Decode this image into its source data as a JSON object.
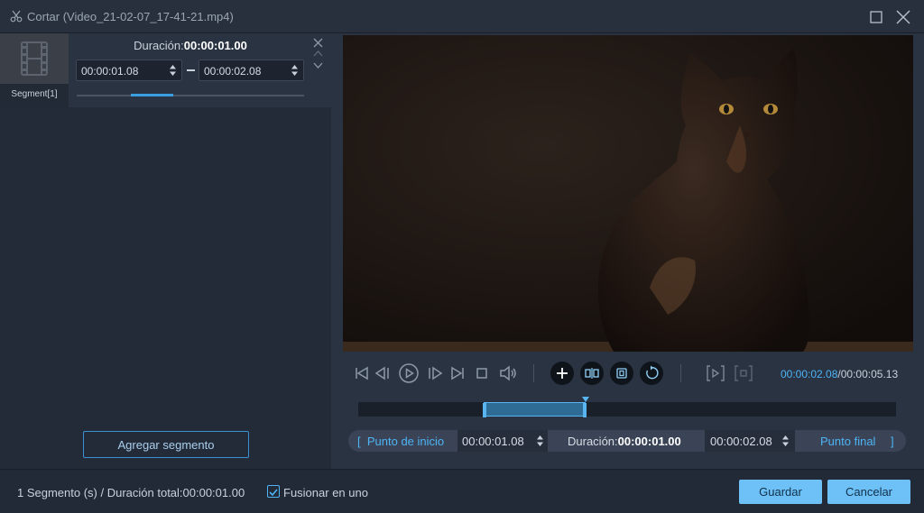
{
  "window": {
    "title": "Cortar (Video_21-02-07_17-41-21.mp4)",
    "icons": [
      "scissors-icon",
      "maximize-icon",
      "close-icon"
    ]
  },
  "segment_list": {
    "items": [
      {
        "label": "Segment[1]",
        "duration_label": "Duración:",
        "duration_value": "00:00:01.00",
        "start": "00:00:01.08",
        "end": "00:00:02.08",
        "range_fraction": [
          0.24,
          0.42
        ]
      }
    ],
    "add_button": "Agregar segmento"
  },
  "player": {
    "current_time": "00:00:02.08",
    "total_time": "/00:00:05.13",
    "selection_fraction": [
      0.21,
      0.42
    ],
    "playhead_fraction": 0.42
  },
  "trim_bar": {
    "start_label": "Punto de inicio",
    "start_value": "00:00:01.08",
    "duration_label": "Duración:",
    "duration_value": "00:00:01.00",
    "end_value": "00:00:02.08",
    "end_label": "Punto final",
    "bracket_left": "[",
    "bracket_right": "]"
  },
  "footer": {
    "summary": "1 Segmento (s) / Duración total:00:00:01.00",
    "merge_label": "Fusionar en uno",
    "merge_checked": true,
    "save": "Guardar",
    "cancel": "Cancelar"
  },
  "colors": {
    "accent": "#4eb4f5",
    "button": "#6ec1f7",
    "panel": "#2a3342",
    "background": "#222a37"
  }
}
